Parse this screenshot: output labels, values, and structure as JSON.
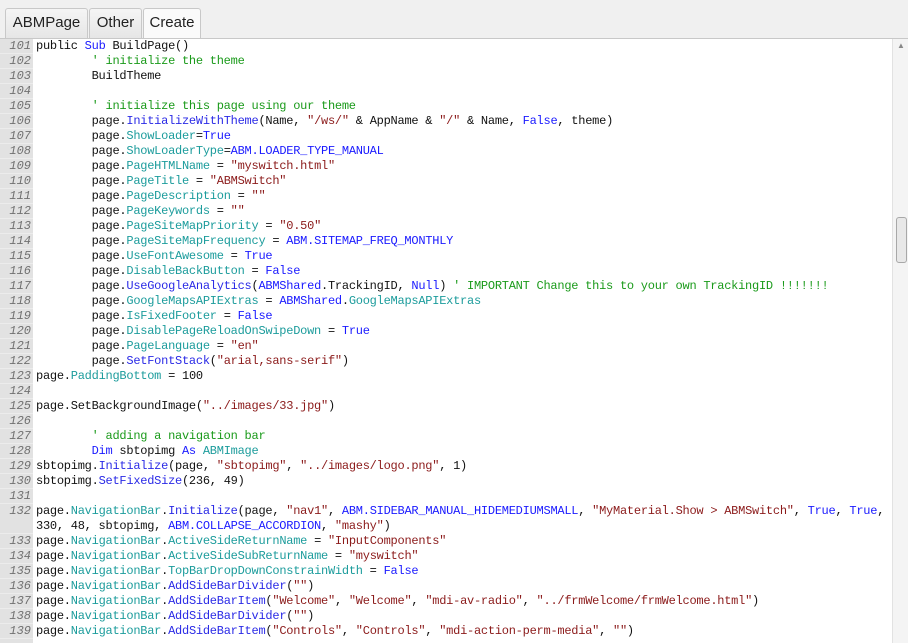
{
  "tabs": [
    {
      "label": "ABMPage",
      "active": false
    },
    {
      "label": "Other",
      "active": false
    },
    {
      "label": "Create",
      "active": true
    }
  ],
  "editor": {
    "lines": [
      {
        "n": "101",
        "t": [
          [
            "n",
            "public "
          ],
          [
            "k",
            "Sub"
          ],
          [
            "n",
            " BuildPage()"
          ]
        ]
      },
      {
        "n": "102",
        "t": [
          [
            "n",
            "        "
          ],
          [
            "c",
            "' initialize the theme"
          ]
        ]
      },
      {
        "n": "103",
        "t": [
          [
            "n",
            "        BuildTheme"
          ]
        ]
      },
      {
        "n": "104",
        "t": []
      },
      {
        "n": "105",
        "t": [
          [
            "n",
            "        "
          ],
          [
            "c",
            "' initialize this page using our theme"
          ]
        ]
      },
      {
        "n": "106",
        "t": [
          [
            "n",
            "        page."
          ],
          [
            "m",
            "InitializeWithTheme"
          ],
          [
            "n",
            "(Name, "
          ],
          [
            "s",
            "\"/ws/\""
          ],
          [
            "n",
            " & AppName & "
          ],
          [
            "s",
            "\"/\""
          ],
          [
            "n",
            " & Name, "
          ],
          [
            "k",
            "False"
          ],
          [
            "n",
            ", theme)"
          ]
        ]
      },
      {
        "n": "107",
        "t": [
          [
            "n",
            "        page."
          ],
          [
            "p",
            "ShowLoader"
          ],
          [
            "n",
            "="
          ],
          [
            "k",
            "True"
          ]
        ]
      },
      {
        "n": "108",
        "t": [
          [
            "n",
            "        page."
          ],
          [
            "p",
            "ShowLoaderType"
          ],
          [
            "n",
            "="
          ],
          [
            "k",
            "ABM.LOADER_TYPE_MANUAL"
          ]
        ]
      },
      {
        "n": "109",
        "t": [
          [
            "n",
            "        page."
          ],
          [
            "p",
            "PageHTMLName"
          ],
          [
            "n",
            " = "
          ],
          [
            "s",
            "\"myswitch.html\""
          ]
        ]
      },
      {
        "n": "110",
        "t": [
          [
            "n",
            "        page."
          ],
          [
            "p",
            "PageTitle"
          ],
          [
            "n",
            " = "
          ],
          [
            "s",
            "\"ABMSwitch\""
          ]
        ]
      },
      {
        "n": "111",
        "t": [
          [
            "n",
            "        page."
          ],
          [
            "p",
            "PageDescription"
          ],
          [
            "n",
            " = "
          ],
          [
            "s",
            "\"\""
          ]
        ]
      },
      {
        "n": "112",
        "t": [
          [
            "n",
            "        page."
          ],
          [
            "p",
            "PageKeywords"
          ],
          [
            "n",
            " = "
          ],
          [
            "s",
            "\"\""
          ]
        ]
      },
      {
        "n": "113",
        "t": [
          [
            "n",
            "        page."
          ],
          [
            "p",
            "PageSiteMapPriority"
          ],
          [
            "n",
            " = "
          ],
          [
            "s",
            "\"0.50\""
          ]
        ]
      },
      {
        "n": "114",
        "t": [
          [
            "n",
            "        page."
          ],
          [
            "p",
            "PageSiteMapFrequency"
          ],
          [
            "n",
            " = "
          ],
          [
            "k",
            "ABM.SITEMAP_FREQ_MONTHLY"
          ]
        ]
      },
      {
        "n": "115",
        "t": [
          [
            "n",
            "        page."
          ],
          [
            "p",
            "UseFontAwesome"
          ],
          [
            "n",
            " = "
          ],
          [
            "k",
            "True"
          ]
        ]
      },
      {
        "n": "116",
        "t": [
          [
            "n",
            "        page."
          ],
          [
            "p",
            "DisableBackButton"
          ],
          [
            "n",
            " = "
          ],
          [
            "k",
            "False"
          ]
        ]
      },
      {
        "n": "117",
        "t": [
          [
            "n",
            "        page."
          ],
          [
            "m",
            "UseGoogleAnalytics"
          ],
          [
            "n",
            "("
          ],
          [
            "k",
            "ABMShared"
          ],
          [
            "n",
            ".TrackingID, "
          ],
          [
            "k",
            "Null"
          ],
          [
            "n",
            ") "
          ],
          [
            "c",
            "' IMPORTANT Change this to your own TrackingID !!!!!!!"
          ]
        ]
      },
      {
        "n": "118",
        "t": [
          [
            "n",
            "        page."
          ],
          [
            "p",
            "GoogleMapsAPIExtras"
          ],
          [
            "n",
            " = "
          ],
          [
            "k",
            "ABMShared"
          ],
          [
            "n",
            "."
          ],
          [
            "p",
            "GoogleMapsAPIExtras"
          ]
        ]
      },
      {
        "n": "119",
        "t": [
          [
            "n",
            "        page."
          ],
          [
            "p",
            "IsFixedFooter"
          ],
          [
            "n",
            " = "
          ],
          [
            "k",
            "False"
          ]
        ]
      },
      {
        "n": "120",
        "t": [
          [
            "n",
            "        page."
          ],
          [
            "p",
            "DisablePageReloadOnSwipeDown"
          ],
          [
            "n",
            " = "
          ],
          [
            "k",
            "True"
          ]
        ]
      },
      {
        "n": "121",
        "t": [
          [
            "n",
            "        page."
          ],
          [
            "p",
            "PageLanguage"
          ],
          [
            "n",
            " = "
          ],
          [
            "s",
            "\"en\""
          ]
        ]
      },
      {
        "n": "122",
        "t": [
          [
            "n",
            "        page."
          ],
          [
            "m",
            "SetFontStack"
          ],
          [
            "n",
            "("
          ],
          [
            "s",
            "\"arial,sans-serif\""
          ],
          [
            "n",
            ")"
          ]
        ]
      },
      {
        "n": "123",
        "t": [
          [
            "n",
            "page."
          ],
          [
            "p",
            "PaddingBottom"
          ],
          [
            "n",
            " = 100"
          ]
        ]
      },
      {
        "n": "124",
        "t": []
      },
      {
        "n": "125",
        "t": [
          [
            "n",
            "page.SetBackgroundImage("
          ],
          [
            "s",
            "\"../images/33.jpg\""
          ],
          [
            "n",
            ")"
          ]
        ]
      },
      {
        "n": "126",
        "t": []
      },
      {
        "n": "127",
        "t": [
          [
            "n",
            "        "
          ],
          [
            "c",
            "' adding a navigation bar"
          ]
        ]
      },
      {
        "n": "128",
        "t": [
          [
            "n",
            "        "
          ],
          [
            "k",
            "Dim"
          ],
          [
            "n",
            " sbtopimg "
          ],
          [
            "k",
            "As"
          ],
          [
            "n",
            " "
          ],
          [
            "p",
            "ABMImage"
          ]
        ]
      },
      {
        "n": "129",
        "t": [
          [
            "n",
            "sbtopimg."
          ],
          [
            "m",
            "Initialize"
          ],
          [
            "n",
            "(page, "
          ],
          [
            "s",
            "\"sbtopimg\""
          ],
          [
            "n",
            ", "
          ],
          [
            "s",
            "\"../images/logo.png\""
          ],
          [
            "n",
            ", 1)"
          ]
        ]
      },
      {
        "n": "130",
        "t": [
          [
            "n",
            "sbtopimg."
          ],
          [
            "m",
            "SetFixedSize"
          ],
          [
            "n",
            "(236, 49)"
          ]
        ]
      },
      {
        "n": "131",
        "t": []
      },
      {
        "n": "132",
        "t": [
          [
            "n",
            "page."
          ],
          [
            "p",
            "NavigationBar"
          ],
          [
            "n",
            "."
          ],
          [
            "m",
            "Initialize"
          ],
          [
            "n",
            "(page, "
          ],
          [
            "s",
            "\"nav1\""
          ],
          [
            "n",
            ", "
          ],
          [
            "k",
            "ABM.SIDEBAR_MANUAL_HIDEMEDIUMSMALL"
          ],
          [
            "n",
            ", "
          ],
          [
            "s",
            "\"MyMaterial.Show > ABMSwitch\""
          ],
          [
            "n",
            ", "
          ],
          [
            "k",
            "True"
          ],
          [
            "n",
            ", "
          ],
          [
            "k",
            "True"
          ],
          [
            "n",
            ", 330, 48, sbtopimg, "
          ],
          [
            "k",
            "ABM.COLLAPSE_ACCORDION"
          ],
          [
            "n",
            ", "
          ],
          [
            "s",
            "\"mashy\""
          ],
          [
            "n",
            ")"
          ]
        ]
      },
      {
        "n": "133",
        "t": [
          [
            "n",
            "page."
          ],
          [
            "p",
            "NavigationBar"
          ],
          [
            "n",
            "."
          ],
          [
            "p",
            "ActiveSideReturnName"
          ],
          [
            "n",
            " = "
          ],
          [
            "s",
            "\"InputComponents\""
          ]
        ]
      },
      {
        "n": "134",
        "t": [
          [
            "n",
            "page."
          ],
          [
            "p",
            "NavigationBar"
          ],
          [
            "n",
            "."
          ],
          [
            "p",
            "ActiveSideSubReturnName"
          ],
          [
            "n",
            " = "
          ],
          [
            "s",
            "\"myswitch\""
          ]
        ]
      },
      {
        "n": "135",
        "t": [
          [
            "n",
            "page."
          ],
          [
            "p",
            "NavigationBar"
          ],
          [
            "n",
            "."
          ],
          [
            "p",
            "TopBarDropDownConstrainWidth"
          ],
          [
            "n",
            " = "
          ],
          [
            "k",
            "False"
          ]
        ]
      },
      {
        "n": "136",
        "t": [
          [
            "n",
            "page."
          ],
          [
            "p",
            "NavigationBar"
          ],
          [
            "n",
            "."
          ],
          [
            "m",
            "AddSideBarDivider"
          ],
          [
            "n",
            "("
          ],
          [
            "s",
            "\"\""
          ],
          [
            "n",
            ")"
          ]
        ]
      },
      {
        "n": "137",
        "t": [
          [
            "n",
            "page."
          ],
          [
            "p",
            "NavigationBar"
          ],
          [
            "n",
            "."
          ],
          [
            "m",
            "AddSideBarItem"
          ],
          [
            "n",
            "("
          ],
          [
            "s",
            "\"Welcome\""
          ],
          [
            "n",
            ", "
          ],
          [
            "s",
            "\"Welcome\""
          ],
          [
            "n",
            ", "
          ],
          [
            "s",
            "\"mdi-av-radio\""
          ],
          [
            "n",
            ", "
          ],
          [
            "s",
            "\"../frmWelcome/frmWelcome.html\""
          ],
          [
            "n",
            ")"
          ]
        ]
      },
      {
        "n": "138",
        "t": [
          [
            "n",
            "page."
          ],
          [
            "p",
            "NavigationBar"
          ],
          [
            "n",
            "."
          ],
          [
            "m",
            "AddSideBarDivider"
          ],
          [
            "n",
            "("
          ],
          [
            "s",
            "\"\""
          ],
          [
            "n",
            ")"
          ]
        ]
      },
      {
        "n": "139",
        "t": [
          [
            "n",
            "page."
          ],
          [
            "p",
            "NavigationBar"
          ],
          [
            "n",
            "."
          ],
          [
            "m",
            "AddSideBarItem"
          ],
          [
            "n",
            "("
          ],
          [
            "s",
            "\"Controls\""
          ],
          [
            "n",
            ", "
          ],
          [
            "s",
            "\"Controls\""
          ],
          [
            "n",
            ", "
          ],
          [
            "s",
            "\"mdi-action-perm-media\""
          ],
          [
            "n",
            ", "
          ],
          [
            "s",
            "\"\""
          ],
          [
            "n",
            ")"
          ]
        ]
      }
    ]
  },
  "colors": {
    "keyword": "#1a1aff",
    "method": "#2a2ae6",
    "property": "#1c9c9c",
    "string": "#8b1a1a",
    "comment": "#1a9a1a"
  }
}
